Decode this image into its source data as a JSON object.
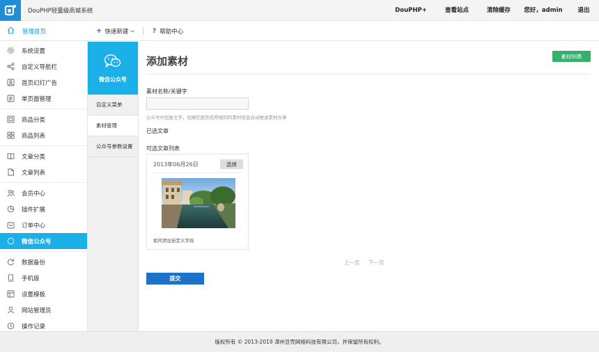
{
  "header": {
    "app_title": "DouPHP轻量级商城系统",
    "nav": [
      "DouPHP+",
      "查看站点",
      "清除缓存",
      "您好，admin",
      "退出"
    ]
  },
  "subbar": {
    "home": "管理首页",
    "quick_new": "快速新建",
    "help": "帮助中心"
  },
  "sidebar": {
    "items": [
      {
        "label": "系统设置",
        "icon": "gear-icon"
      },
      {
        "label": "自定义导航栏",
        "icon": "share-icon"
      },
      {
        "label": "首页幻灯广告",
        "icon": "image-icon"
      },
      {
        "label": "单页面管理",
        "icon": "page-icon"
      },
      {
        "label": "商品分类",
        "icon": "category-icon"
      },
      {
        "label": "商品列表",
        "icon": "grid-icon"
      },
      {
        "label": "文章分类",
        "icon": "book-icon"
      },
      {
        "label": "文章列表",
        "icon": "file-icon"
      },
      {
        "label": "会员中心",
        "icon": "users-icon"
      },
      {
        "label": "插件扩展",
        "icon": "puzzle-icon"
      },
      {
        "label": "订单中心",
        "icon": "order-icon"
      },
      {
        "label": "微信公众号",
        "icon": "wechat-icon"
      },
      {
        "label": "数据备份",
        "icon": "refresh-icon"
      },
      {
        "label": "手机版",
        "icon": "mobile-icon"
      },
      {
        "label": "设置模板",
        "icon": "template-icon"
      },
      {
        "label": "网站管理员",
        "icon": "user-icon"
      },
      {
        "label": "操作记录",
        "icon": "clock-icon"
      }
    ],
    "active": "微信公众号"
  },
  "subside": {
    "header": "微信公众号",
    "items": [
      "自定义菜单",
      "素材管理",
      "公众号参数设置"
    ],
    "active": "素材管理"
  },
  "main": {
    "title": "添加素材",
    "list_button": "素材列表",
    "name_label": "素材名称/关键字",
    "name_value": "",
    "name_tip": "公众号中回复文字，如果匹配到名称相同的素材就会自动推送素材文章",
    "selected_label": "已选文章",
    "available_label": "可选文章列表",
    "card": {
      "date": "2013年06月26日",
      "select_button": "选择",
      "caption": "如何添加自定义字段"
    },
    "prev": "上一页",
    "next": "下一页",
    "submit": "提交"
  },
  "footer": {
    "text": "版权所有 © 2013-2019 漳州豆壳网络科技有限公司，并保留所有权利。"
  },
  "colors": {
    "brand_blue": "#1e8fd6",
    "active_cyan": "#1cb0e8",
    "green_button": "#31b16b",
    "submit_blue": "#1c71c8"
  }
}
